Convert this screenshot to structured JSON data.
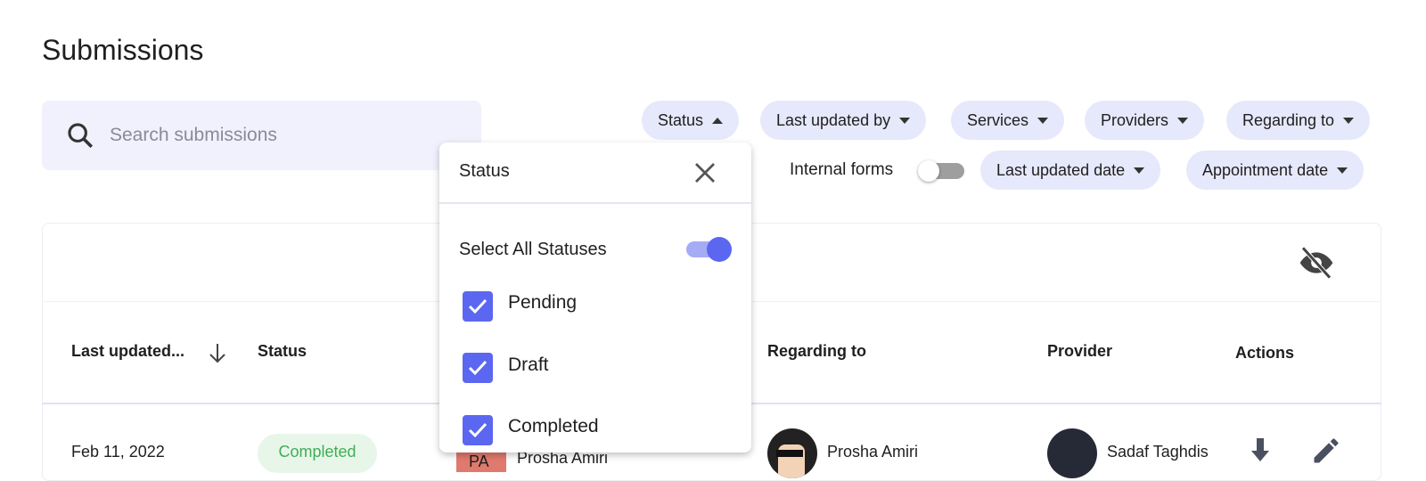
{
  "page": {
    "title": "Submissions"
  },
  "search": {
    "placeholder": "Search submissions",
    "icon": "search-icon"
  },
  "filters": {
    "status": "Status",
    "last_updated_by": "Last updated by",
    "services": "Services",
    "providers": "Providers",
    "regarding_to": "Regarding to",
    "internal_forms": "Internal forms",
    "internal_forms_on": false,
    "last_updated_date": "Last updated date",
    "appointment_date": "Appointment date"
  },
  "table": {
    "columns": [
      "Last updated...",
      "Status",
      "Regarding to",
      "Provider",
      "Actions"
    ],
    "rows": [
      {
        "date": "Feb 11, 2022",
        "status": "Completed",
        "submitter_initials": "PA",
        "submitter": "Prosha Amiri",
        "regarding": "Prosha Amiri",
        "provider": "Sadaf Taghdis"
      }
    ]
  },
  "status_dropdown": {
    "title": "Status",
    "select_all_label": "Select All Statuses",
    "select_all_on": true,
    "options": [
      {
        "label": "Pending",
        "checked": true
      },
      {
        "label": "Draft",
        "checked": true
      },
      {
        "label": "Completed",
        "checked": true
      }
    ]
  },
  "colors": {
    "accent": "#5b67f0",
    "chip": "#e6e8fb",
    "completed_text": "#3fae55",
    "completed_bg": "#e8f6ea"
  }
}
